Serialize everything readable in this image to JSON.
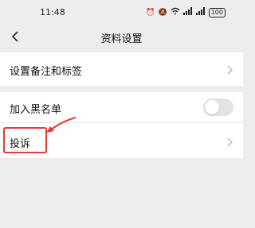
{
  "status_bar": {
    "time": "11:48",
    "battery": "100"
  },
  "header": {
    "title": "资料设置"
  },
  "settings": {
    "remark_label": "设置备注和标签",
    "blacklist_label": "加入黑名单",
    "blacklist_enabled": false,
    "report_label": "投诉"
  },
  "annotation": {
    "color": "#e53935"
  }
}
